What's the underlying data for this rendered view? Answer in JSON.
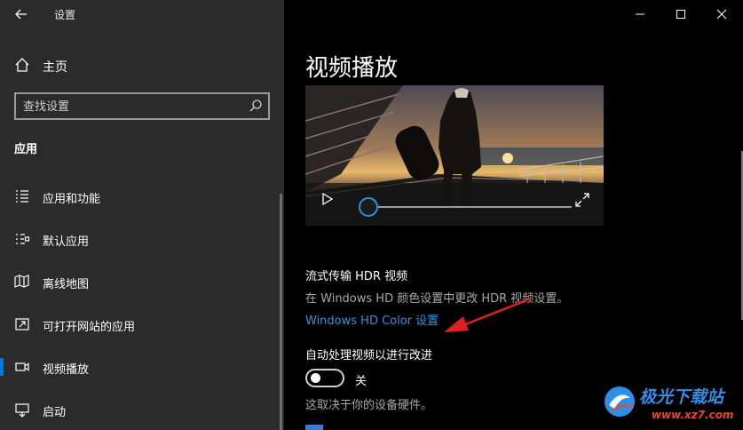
{
  "window": {
    "title": "设置"
  },
  "sidebar": {
    "home_label": "主页",
    "search_placeholder": "查找设置",
    "section": "应用",
    "items": [
      {
        "label": "应用和功能",
        "icon": "list-icon",
        "selected": false
      },
      {
        "label": "默认应用",
        "icon": "default-apps-icon",
        "selected": false
      },
      {
        "label": "离线地图",
        "icon": "map-icon",
        "selected": false
      },
      {
        "label": "可打开网站的应用",
        "icon": "open-in-app-icon",
        "selected": false
      },
      {
        "label": "视频播放",
        "icon": "video-icon",
        "selected": true
      },
      {
        "label": "启动",
        "icon": "startup-icon",
        "selected": false
      }
    ]
  },
  "main": {
    "page_title": "视频播放",
    "video": {
      "progress": 0
    },
    "hdr": {
      "title": "流式传输 HDR 视频",
      "description": "在 Windows HD 颜色设置中更改 HDR 视频设置。",
      "link": "Windows HD Color 设置"
    },
    "auto_process": {
      "title": "自动处理视频以进行改进",
      "toggle_state": "关",
      "description": "这取决于你的设备硬件。"
    }
  },
  "watermark": {
    "brand": "极光下载站",
    "url": "www.xz7.com"
  },
  "colors": {
    "accent": "#0078d7",
    "link": "#3b8fe0",
    "sidebar_bg": "#2b2b2b",
    "main_bg": "#000000",
    "annotation_arrow": "#e02020"
  }
}
